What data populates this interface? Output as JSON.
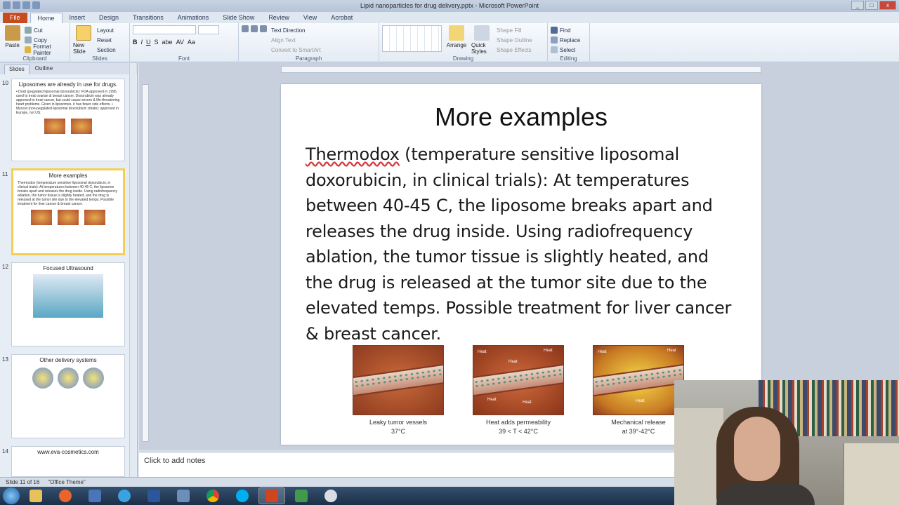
{
  "window": {
    "title": "Lipid nanoparticles for drug delivery.pptx - Microsoft PowerPoint",
    "min": "_",
    "max": "□",
    "close": "x"
  },
  "tabs": [
    "File",
    "Home",
    "Insert",
    "Design",
    "Transitions",
    "Animations",
    "Slide Show",
    "Review",
    "View",
    "Acrobat"
  ],
  "ribbon": {
    "clipboard": {
      "label": "Clipboard",
      "paste": "Paste",
      "cut": "Cut",
      "copy": "Copy",
      "format_painter": "Format Painter"
    },
    "slides": {
      "label": "Slides",
      "new_slide": "New Slide",
      "layout": "Layout",
      "reset": "Reset",
      "section": "Section"
    },
    "font": {
      "label": "Font",
      "bold": "B",
      "italic": "I",
      "underline": "U",
      "shadow": "S",
      "strike": "abe",
      "spacing": "AV",
      "case": "Aa"
    },
    "paragraph": {
      "label": "Paragraph",
      "text_direction": "Text Direction",
      "align_text": "Align Text",
      "smartart": "Convert to SmartArt"
    },
    "drawing": {
      "label": "Drawing",
      "arrange": "Arrange",
      "quick_styles": "Quick Styles",
      "shape_fill": "Shape Fill",
      "shape_outline": "Shape Outline",
      "shape_effects": "Shape Effects"
    },
    "editing": {
      "label": "Editing",
      "find": "Find",
      "replace": "Replace",
      "select": "Select"
    }
  },
  "left_pane": {
    "tabs": [
      "Slides",
      "Outline"
    ],
    "close": "×",
    "slides": [
      {
        "num": "10",
        "title": "Liposomes are already in use for drugs.",
        "body": "• Doxil (pegylated liposomal doxorubicin): FDA approved in 1995, used to treat ovarian & breast cancer. Doxorubicin was already approved to treat cancer, but could cause severe & life-threatening heart problems. Given in liposomes, it has fewer side effects. • Myocet (non-pegylated liposomal doxorubicin citrate): approved in Europe, not US."
      },
      {
        "num": "11",
        "title": "More examples",
        "body": "Thermodox (temperature sensitive liposomal doxorubicin, in clinical trials): At temperatures between 40-45 C, the liposome breaks apart and releases the drug inside. Using radiofrequency ablation, the tumor tissue is slightly heated, and the drug is released at the tumor site due to the elevated temps. Possible treatment for liver cancer & breast cancer."
      },
      {
        "num": "12",
        "title": "Focused Ultrasound",
        "body": ""
      },
      {
        "num": "13",
        "title": "Other delivery systems",
        "body": ""
      },
      {
        "num": "14",
        "title": "www.eva-cosmetics.com",
        "body": ""
      }
    ]
  },
  "slide": {
    "title": "More examples",
    "term": "Thermodox",
    "body_rest": " (temperature sensitive liposomal doxorubicin, in clinical trials): At temperatures between 40-45 C, the liposome breaks apart and releases the drug inside. Using radiofrequency ablation, the tumor tissue is slightly heated, and the drug is released at the tumor site due to the elevated temps. Possible treatment for liver cancer & breast cancer.",
    "figures": [
      {
        "caption": "Leaky tumor vessels",
        "sub": "37°C"
      },
      {
        "caption": "Heat adds permeability",
        "sub": "39 < T < 42°C"
      },
      {
        "caption": "Mechanical release",
        "sub": "at 39°-42°C"
      }
    ],
    "heat_label": "Heat"
  },
  "notes": {
    "placeholder": "Click to add notes"
  },
  "status": {
    "slide": "Slide 11 of 16",
    "theme": "\"Office Theme\""
  },
  "colors": {
    "file_tab": "#c74b21",
    "selected_thumb": "#f4cf53"
  }
}
